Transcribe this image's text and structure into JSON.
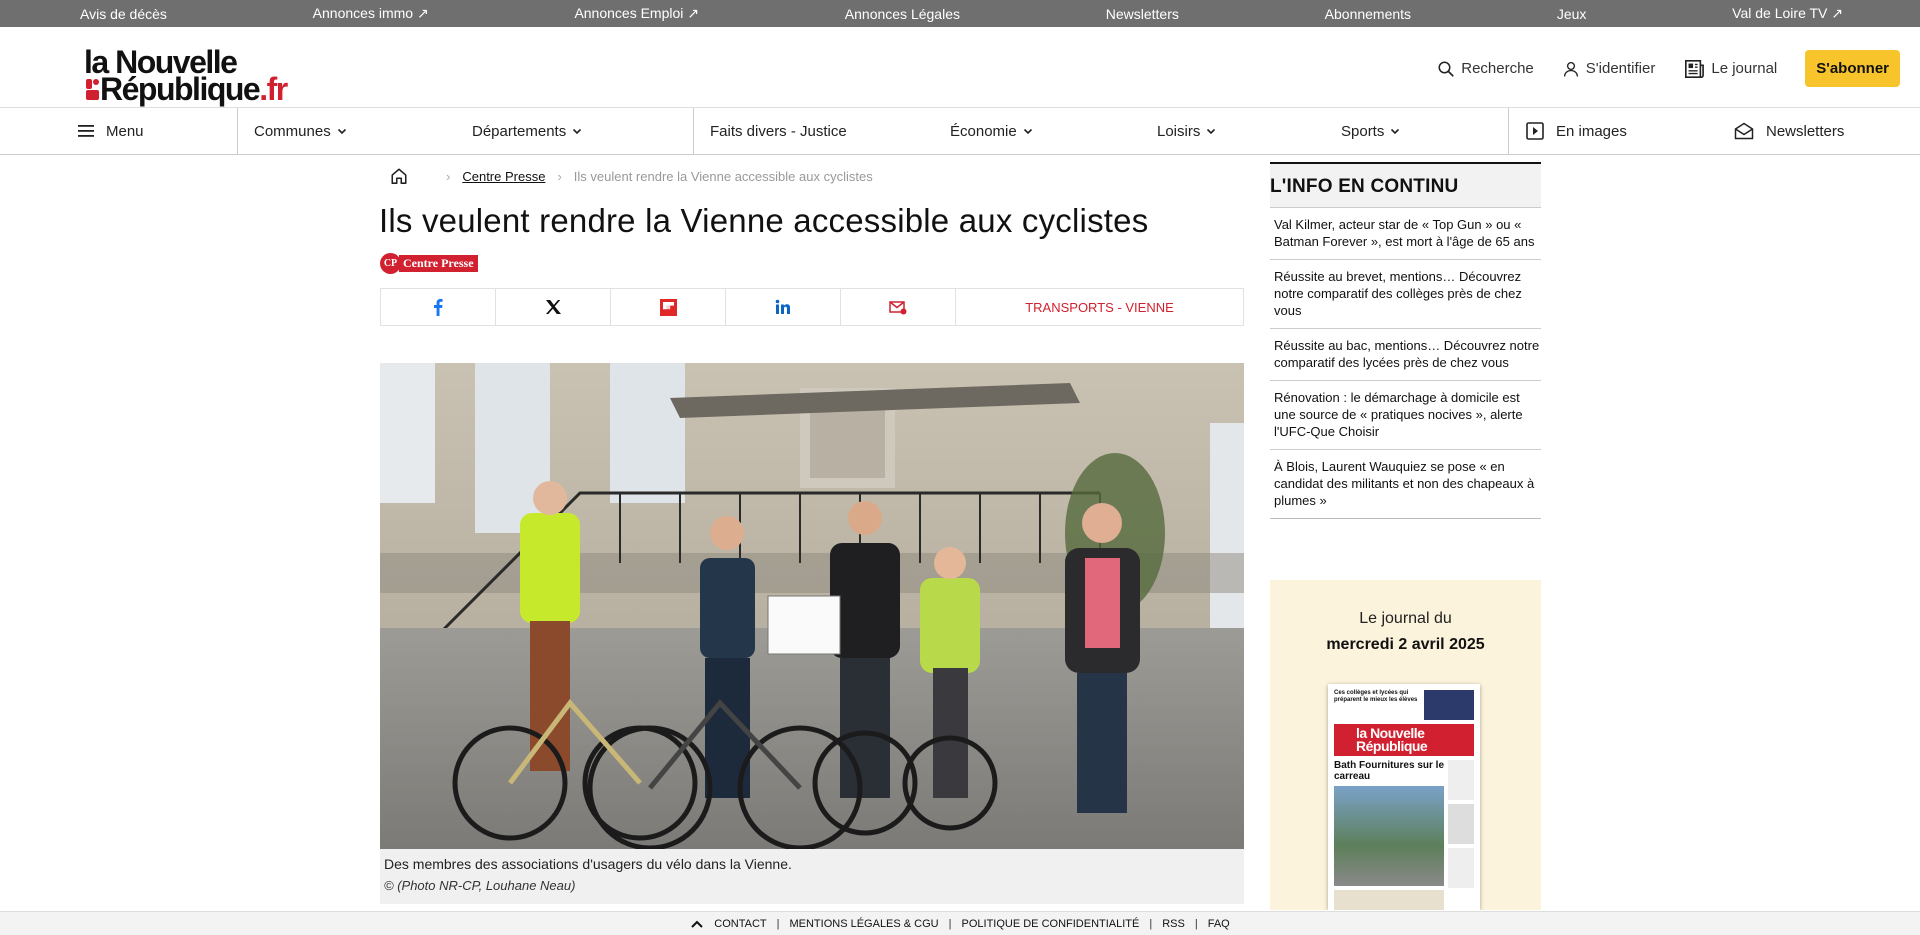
{
  "topbar": {
    "items": [
      {
        "label": "Avis de décès"
      },
      {
        "label": "Annonces immo ↗"
      },
      {
        "label": "Annonces Emploi ↗"
      },
      {
        "label": "Annonces Légales"
      },
      {
        "label": "Newsletters"
      },
      {
        "label": "Abonnements"
      },
      {
        "label": "Jeux"
      },
      {
        "label": "Val de Loire TV ↗"
      }
    ]
  },
  "header": {
    "logo_line1": "la Nouvelle",
    "logo_line2": "République",
    "logo_tld": ".fr",
    "search_label": "Recherche",
    "login_label": "S'identifier",
    "journal_label": "Le journal",
    "subscribe_label": "S'abonner"
  },
  "nav": {
    "menu": "Menu",
    "communes": "Communes",
    "departements": "Départements",
    "faits_divers": "Faits divers - Justice",
    "economie": "Économie",
    "loisirs": "Loisirs",
    "sports": "Sports",
    "en_images": "En images",
    "newsletters": "Newsletters"
  },
  "breadcrumb": {
    "section": "Centre Presse",
    "current": "Ils veulent rendre la Vienne accessible aux cyclistes"
  },
  "article": {
    "title": "Ils veulent rendre la Vienne accessible aux cyclistes",
    "source_short": "CP",
    "source_name": "Centre Presse",
    "tags": "TRANSPORTS - VIENNE",
    "caption": "Des membres des associations d'usagers du vélo dans la Vienne.",
    "credit": "© (Photo NR-CP, Louhane Neau)"
  },
  "sidebar": {
    "heading": "L'INFO EN CONTINU",
    "items": [
      {
        "text": "Val Kilmer, acteur star de « Top Gun » ou « Batman Forever », est mort à l'âge de 65 ans"
      },
      {
        "text": "Réussite au brevet, mentions… Découvrez notre comparatif des collèges près de chez vous"
      },
      {
        "text": "Réussite au bac, mentions… Découvrez notre comparatif des lycées près de chez vous"
      },
      {
        "text": "Rénovation : le démarchage à domicile est une source de « pratiques nocives », alerte l'UFC-Que Choisir"
      },
      {
        "text": "À Blois, Laurent Wauquiez se pose « en candidat des militants et non des chapeaux à plumes »"
      }
    ],
    "journal_line1": "Le journal du",
    "journal_date": "mercredi 2 avril 2025",
    "cover_headline": "Bath Fournitures sur le carreau",
    "cover_top": "Ces collèges et lycées qui préparent le mieux les élèves"
  },
  "footer": {
    "items": [
      "CONTACT",
      "MENTIONS LÉGALES & CGU",
      "POLITIQUE DE CONFIDENTIALITÉ",
      "RSS",
      "FAQ"
    ]
  },
  "colors": {
    "brand_red": "#d1202f",
    "subscribe_yellow": "#f7c52b",
    "topbar_gray": "#6f6f6f"
  }
}
